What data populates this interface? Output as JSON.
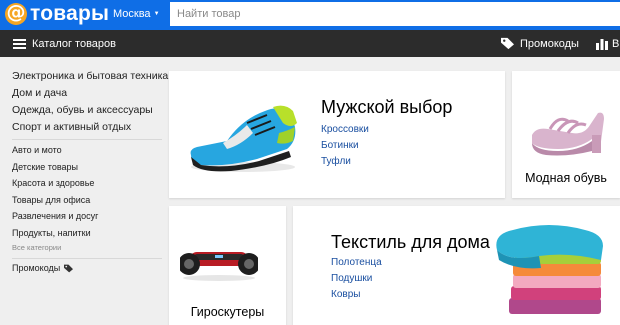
{
  "header": {
    "logo_text": "товары",
    "region": "Москва",
    "search_placeholder": "Найти товар"
  },
  "nav": {
    "catalog_label": "Каталог товаров",
    "promo_label": "Промокоды",
    "stats_label": "В"
  },
  "sidebar": {
    "main_items": [
      "Электроника и бытовая техника",
      "Дом и дача",
      "Одежда, обувь и аксессуары",
      "Спорт и активный отдых"
    ],
    "sub_items": [
      "Авто и мото",
      "Детские товары",
      "Красота и здоровье",
      "Товары для офиса",
      "Развлечения и досуг",
      "Продукты, напитки"
    ],
    "all_categories": "Все категории",
    "promo": "Промокоды"
  },
  "cards": {
    "mens": {
      "title": "Мужской выбор",
      "links": [
        "Кроссовки",
        "Ботинки",
        "Туфли"
      ]
    },
    "womens_shoes": {
      "caption": "Модная обувь"
    },
    "gyro": {
      "caption": "Гироскутеры"
    },
    "textile": {
      "title": "Текстиль для дома",
      "links": [
        "Полотенца",
        "Подушки",
        "Ковры"
      ]
    }
  },
  "colors": {
    "brand_blue": "#0f6ee6",
    "logo_orange": "#f5a623",
    "nav_dark": "#2c2c2c",
    "link_blue": "#1a4fa0"
  }
}
